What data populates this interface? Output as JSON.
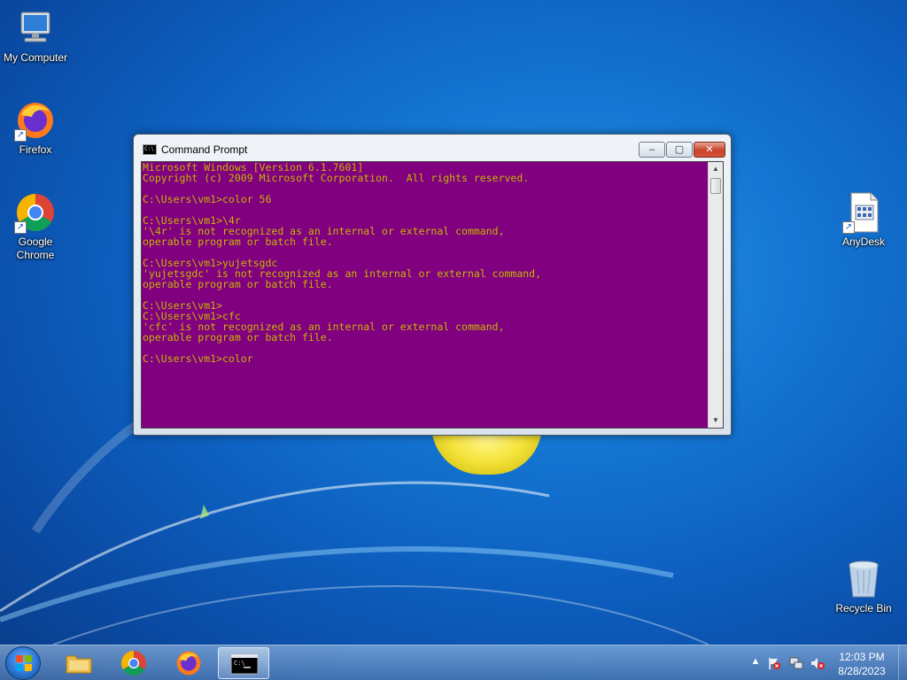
{
  "desktop": {
    "icons": [
      {
        "label": "My Computer"
      },
      {
        "label": "Firefox"
      },
      {
        "label": "Google Chrome"
      },
      {
        "label": "AnyDesk"
      },
      {
        "label": "Recycle Bin"
      }
    ]
  },
  "window": {
    "title": "Command Prompt",
    "minimize": "–",
    "maximize": "▢",
    "close": "✕",
    "console_colors": {
      "background": "#800080",
      "foreground": "#c8b400"
    },
    "console_lines": [
      "Microsoft Windows [Version 6.1.7601]",
      "Copyright (c) 2009 Microsoft Corporation.  All rights reserved.",
      "",
      "C:\\Users\\vm1>color 56",
      "",
      "C:\\Users\\vm1>\\4r",
      "'\\4r' is not recognized as an internal or external command,",
      "operable program or batch file.",
      "",
      "C:\\Users\\vm1>yujetsgdc",
      "'yujetsgdc' is not recognized as an internal or external command,",
      "operable program or batch file.",
      "",
      "C:\\Users\\vm1>",
      "C:\\Users\\vm1>cfc",
      "'cfc' is not recognized as an internal or external command,",
      "operable program or batch file.",
      "",
      "C:\\Users\\vm1>color"
    ]
  },
  "taskbar": {
    "clock_time": "12:03 PM",
    "clock_date": "8/28/2023",
    "tray_chevron": "▲"
  }
}
